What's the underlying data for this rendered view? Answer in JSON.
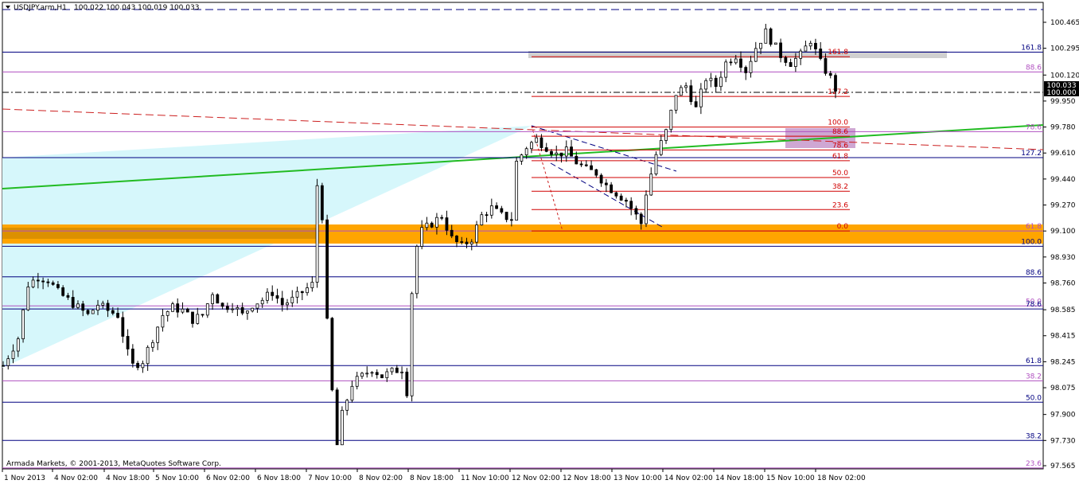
{
  "header": {
    "symbol": "USDJPY.arm,H1",
    "ohlc": "100.022 100.043 100.019 100.033"
  },
  "copyright": "Armada Markets, © 2001-2013, MetaQuotes Software Corp.",
  "colors": {
    "candle": "#000000",
    "fib_red": "#d00000",
    "fib_purple": "#b050c0",
    "fib_blue": "#000080",
    "channel_cyan": "#d6f7fb",
    "support_orange": "#ffa500",
    "trend_green": "#22bb22",
    "dashed_red": "#cc2020"
  },
  "chart_data": {
    "type": "candlestick",
    "symbol": "USDJPY.arm",
    "timeframe": "H1",
    "ylim": [
      97.565,
      100.52
    ],
    "y_ticks": [
      "100.465",
      "100.295",
      "100.120",
      "99.950",
      "99.780",
      "99.610",
      "99.440",
      "99.270",
      "99.100",
      "98.930",
      "98.760",
      "98.585",
      "98.415",
      "98.245",
      "98.075",
      "97.900",
      "97.730",
      "97.565"
    ],
    "current_price": "100.033",
    "round_level": "100.000",
    "x_ticks": [
      "1 Nov 2013",
      "4 Nov 02:00",
      "4 Nov 18:00",
      "5 Nov 10:00",
      "6 Nov 02:00",
      "6 Nov 18:00",
      "7 Nov 10:00",
      "8 Nov 02:00",
      "8 Nov 18:00",
      "11 Nov 10:00",
      "12 Nov 02:00",
      "12 Nov 18:00",
      "13 Nov 10:00",
      "14 Nov 02:00",
      "14 Nov 18:00",
      "15 Nov 10:00",
      "18 Nov 02:00"
    ],
    "close_path": [
      [
        0,
        98.22
      ],
      [
        3,
        98.4
      ],
      [
        5,
        98.75
      ],
      [
        7,
        98.8
      ],
      [
        9,
        98.78
      ],
      [
        11,
        98.7
      ],
      [
        13,
        98.65
      ],
      [
        15,
        98.6
      ],
      [
        17,
        98.55
      ],
      [
        19,
        98.62
      ],
      [
        21,
        98.58
      ],
      [
        23,
        98.55
      ],
      [
        25,
        98.3
      ],
      [
        26,
        98.22
      ],
      [
        28,
        98.25
      ],
      [
        30,
        98.4
      ],
      [
        32,
        98.55
      ],
      [
        34,
        98.6
      ],
      [
        36,
        98.58
      ],
      [
        38,
        98.52
      ],
      [
        40,
        98.55
      ],
      [
        42,
        98.7
      ],
      [
        44,
        98.6
      ],
      [
        46,
        98.62
      ],
      [
        48,
        98.55
      ],
      [
        50,
        98.62
      ],
      [
        52,
        98.65
      ],
      [
        54,
        98.7
      ],
      [
        56,
        98.62
      ],
      [
        58,
        98.65
      ],
      [
        60,
        98.7
      ],
      [
        62,
        98.75
      ],
      [
        63,
        99.4
      ],
      [
        64,
        99.2
      ],
      [
        65,
        98.5
      ],
      [
        66,
        98.05
      ],
      [
        67,
        97.7
      ],
      [
        68,
        97.9
      ],
      [
        70,
        98.1
      ],
      [
        72,
        98.15
      ],
      [
        74,
        98.2
      ],
      [
        76,
        98.15
      ],
      [
        78,
        98.18
      ],
      [
        80,
        98.2
      ],
      [
        81,
        98.05
      ],
      [
        82,
        98.7
      ],
      [
        83,
        99.0
      ],
      [
        84,
        99.1
      ],
      [
        86,
        99.15
      ],
      [
        88,
        99.2
      ],
      [
        90,
        99.05
      ],
      [
        92,
        99.0
      ],
      [
        94,
        99.05
      ],
      [
        96,
        99.2
      ],
      [
        98,
        99.25
      ],
      [
        100,
        99.2
      ],
      [
        102,
        99.18
      ],
      [
        103,
        99.55
      ],
      [
        105,
        99.65
      ],
      [
        107,
        99.7
      ],
      [
        109,
        99.65
      ],
      [
        111,
        99.6
      ],
      [
        113,
        99.62
      ],
      [
        115,
        99.55
      ],
      [
        117,
        99.5
      ],
      [
        119,
        99.48
      ],
      [
        121,
        99.4
      ],
      [
        123,
        99.35
      ],
      [
        125,
        99.3
      ],
      [
        127,
        99.2
      ],
      [
        128,
        99.15
      ],
      [
        129,
        99.35
      ],
      [
        131,
        99.6
      ],
      [
        133,
        99.75
      ],
      [
        135,
        100.0
      ],
      [
        137,
        100.05
      ],
      [
        139,
        99.9
      ],
      [
        141,
        100.1
      ],
      [
        143,
        100.05
      ],
      [
        145,
        100.2
      ],
      [
        147,
        100.25
      ],
      [
        149,
        100.15
      ],
      [
        151,
        100.3
      ],
      [
        153,
        100.4
      ],
      [
        154,
        100.35
      ],
      [
        156,
        100.25
      ],
      [
        158,
        100.2
      ],
      [
        160,
        100.25
      ],
      [
        162,
        100.35
      ],
      [
        164,
        100.2
      ],
      [
        166,
        100.1
      ],
      [
        167,
        100.03
      ]
    ],
    "fib_right": [
      {
        "label": "161.8",
        "price": 100.27,
        "color": "fib_blue"
      },
      {
        "label": "88.6",
        "price": 100.14,
        "color": "fib_purple"
      },
      {
        "label": "78.6",
        "price": 99.75,
        "color": "fib_purple"
      },
      {
        "label": "127.2",
        "price": 99.58,
        "color": "fib_blue"
      },
      {
        "label": "61.8",
        "price": 99.1,
        "color": "fib_purple"
      },
      {
        "label": "100.0",
        "price": 99.0,
        "color": "fib_blue"
      },
      {
        "label": "88.6",
        "price": 98.8,
        "color": "fib_blue"
      },
      {
        "label": "50.0",
        "price": 98.61,
        "color": "fib_purple"
      },
      {
        "label": "78.6",
        "price": 98.59,
        "color": "fib_blue"
      },
      {
        "label": "61.8",
        "price": 98.22,
        "color": "fib_blue"
      },
      {
        "label": "38.2",
        "price": 98.12,
        "color": "fib_purple"
      },
      {
        "label": "50.0",
        "price": 97.98,
        "color": "fib_blue"
      },
      {
        "label": "38.2",
        "price": 97.73,
        "color": "fib_blue"
      },
      {
        "label": "23.6",
        "price": 97.55,
        "color": "fib_purple"
      }
    ],
    "fib_local": [
      {
        "label": "161.8",
        "price": 100.24
      },
      {
        "label": "127.2",
        "price": 99.98
      },
      {
        "label": "100.0",
        "price": 99.78
      },
      {
        "label": "88.6",
        "price": 99.72
      },
      {
        "label": "78.6",
        "price": 99.63
      },
      {
        "label": "61.8",
        "price": 99.56
      },
      {
        "label": "50.0",
        "price": 99.45
      },
      {
        "label": "38.2",
        "price": 99.36
      },
      {
        "label": "23.6",
        "price": 99.24
      },
      {
        "label": "0.0",
        "price": 99.1
      }
    ]
  }
}
